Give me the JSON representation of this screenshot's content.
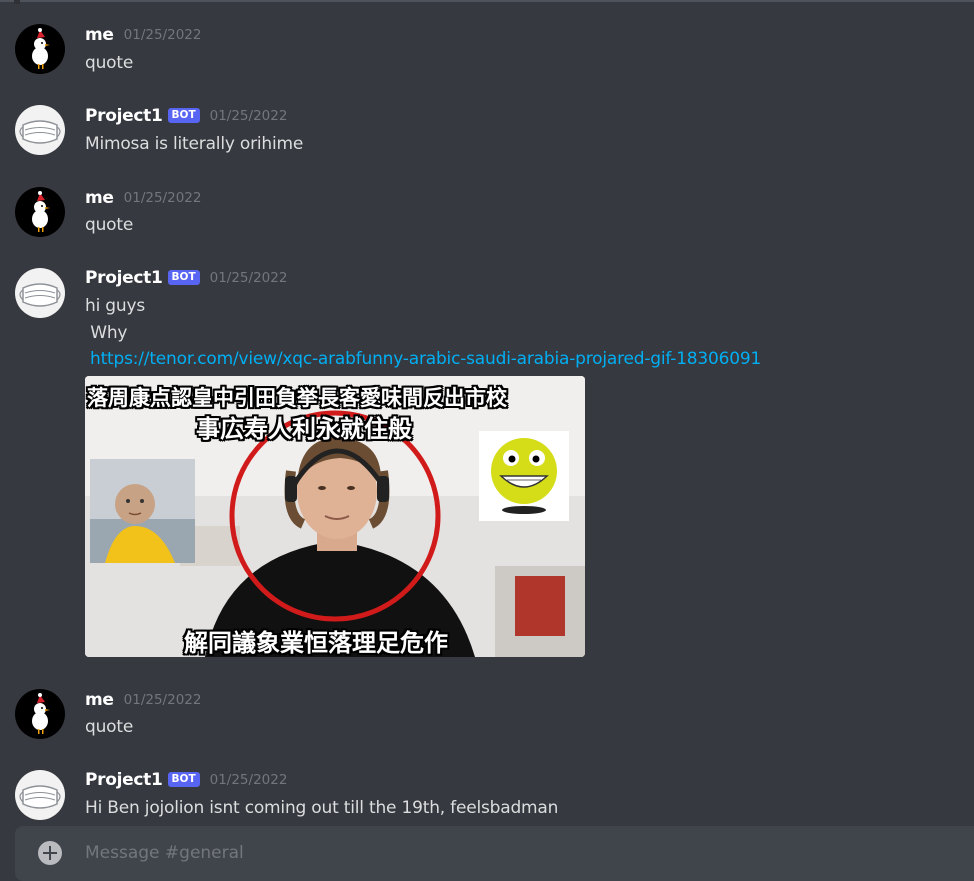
{
  "messages": [
    {
      "username": "me",
      "is_bot": false,
      "timestamp": "01/25/2022",
      "lines": [
        "quote"
      ]
    },
    {
      "username": "Project1",
      "is_bot": true,
      "bot_label": "BOT",
      "timestamp": "01/25/2022",
      "lines": [
        "Mimosa is literally orihime"
      ]
    },
    {
      "username": "me",
      "is_bot": false,
      "timestamp": "01/25/2022",
      "lines": [
        "quote"
      ]
    },
    {
      "username": "Project1",
      "is_bot": true,
      "bot_label": "BOT",
      "timestamp": "01/25/2022",
      "lines": [
        "hi guys",
        " Why"
      ],
      "link": "https://tenor.com/view/xqc-arabfunny-arabic-saudi-arabia-projared-gif-18306091",
      "embed": {
        "caption_top_1": "落周康点認皇中引田負挙長客愛味間反出市校",
        "caption_top_2": "事広寿人利永就住般",
        "caption_bottom": "解同議象業恒落理足危作"
      }
    },
    {
      "username": "me",
      "is_bot": false,
      "timestamp": "01/25/2022",
      "lines": [
        "quote"
      ]
    },
    {
      "username": "Project1",
      "is_bot": true,
      "bot_label": "BOT",
      "timestamp": "01/25/2022",
      "lines": [
        "Hi Ben jojolion isnt coming out till the 19th, feelsbadman"
      ]
    }
  ],
  "composer": {
    "placeholder": "Message #general"
  },
  "colors": {
    "background": "#36393f",
    "bot_tag": "#5865f2",
    "link": "#00aff4",
    "timestamp": "#72767d",
    "composer": "#40444b"
  }
}
